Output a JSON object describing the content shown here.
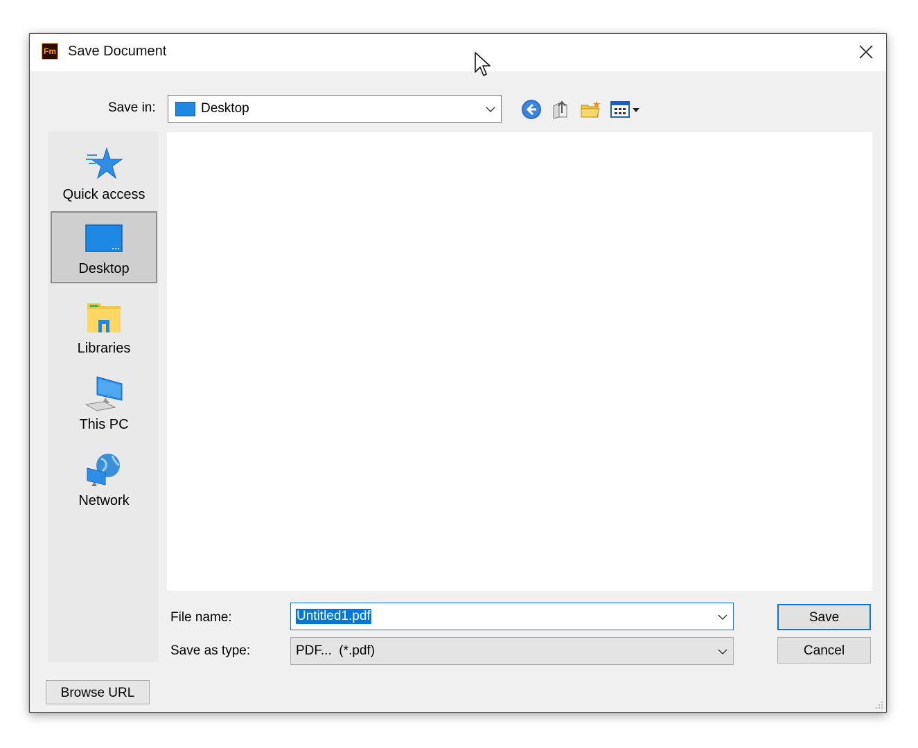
{
  "window": {
    "title": "Save Document",
    "app_icon_text": "Fm"
  },
  "toolbar": {
    "save_in_label": "Save in:",
    "save_in_value": "Desktop",
    "icons": [
      "back-icon",
      "up-folder-icon",
      "new-folder-icon",
      "view-menu-icon"
    ]
  },
  "places": [
    {
      "label": "Quick access",
      "icon": "quick-access-star-icon",
      "selected": false
    },
    {
      "label": "Desktop",
      "icon": "desktop-icon",
      "selected": true
    },
    {
      "label": "Libraries",
      "icon": "libraries-icon",
      "selected": false
    },
    {
      "label": "This PC",
      "icon": "this-pc-icon",
      "selected": false
    },
    {
      "label": "Network",
      "icon": "network-icon",
      "selected": false
    }
  ],
  "form": {
    "file_name_label": "File name:",
    "file_name_value": "Untitled1.pdf",
    "save_as_type_label": "Save as type:",
    "save_as_type_value": "PDF...  (*.pdf)"
  },
  "buttons": {
    "save": "Save",
    "cancel": "Cancel",
    "browse_url": "Browse URL"
  },
  "colors": {
    "accent": "#0078d7",
    "dialog_bg": "#f0f0f0",
    "app_icon_orange": "#ff9a00"
  }
}
